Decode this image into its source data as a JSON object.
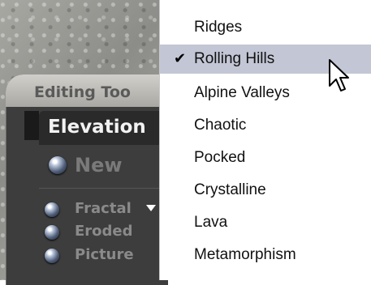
{
  "panel": {
    "title": "Editing Too",
    "tab_label": "Elevation",
    "new_label": "New",
    "options": [
      {
        "label": "Fractal"
      },
      {
        "label": "Eroded"
      },
      {
        "label": "Picture"
      }
    ]
  },
  "menu": {
    "items": [
      {
        "label": "Ridges",
        "checked": false
      },
      {
        "label": "Rolling Hills",
        "checked": true
      },
      {
        "label": "Alpine Valleys",
        "checked": false
      },
      {
        "label": "Chaotic",
        "checked": false
      },
      {
        "label": "Pocked",
        "checked": false
      },
      {
        "label": "Crystalline",
        "checked": false
      },
      {
        "label": "Lava",
        "checked": false
      },
      {
        "label": "Metamorphism",
        "checked": false
      }
    ],
    "check_glyph": "✔",
    "selected_color": "#c3c6d4"
  },
  "icons": {
    "cursor": "arrow-cursor-icon",
    "radio": "radio-orb-icon",
    "dropdown": "dropdown-triangle-icon"
  }
}
